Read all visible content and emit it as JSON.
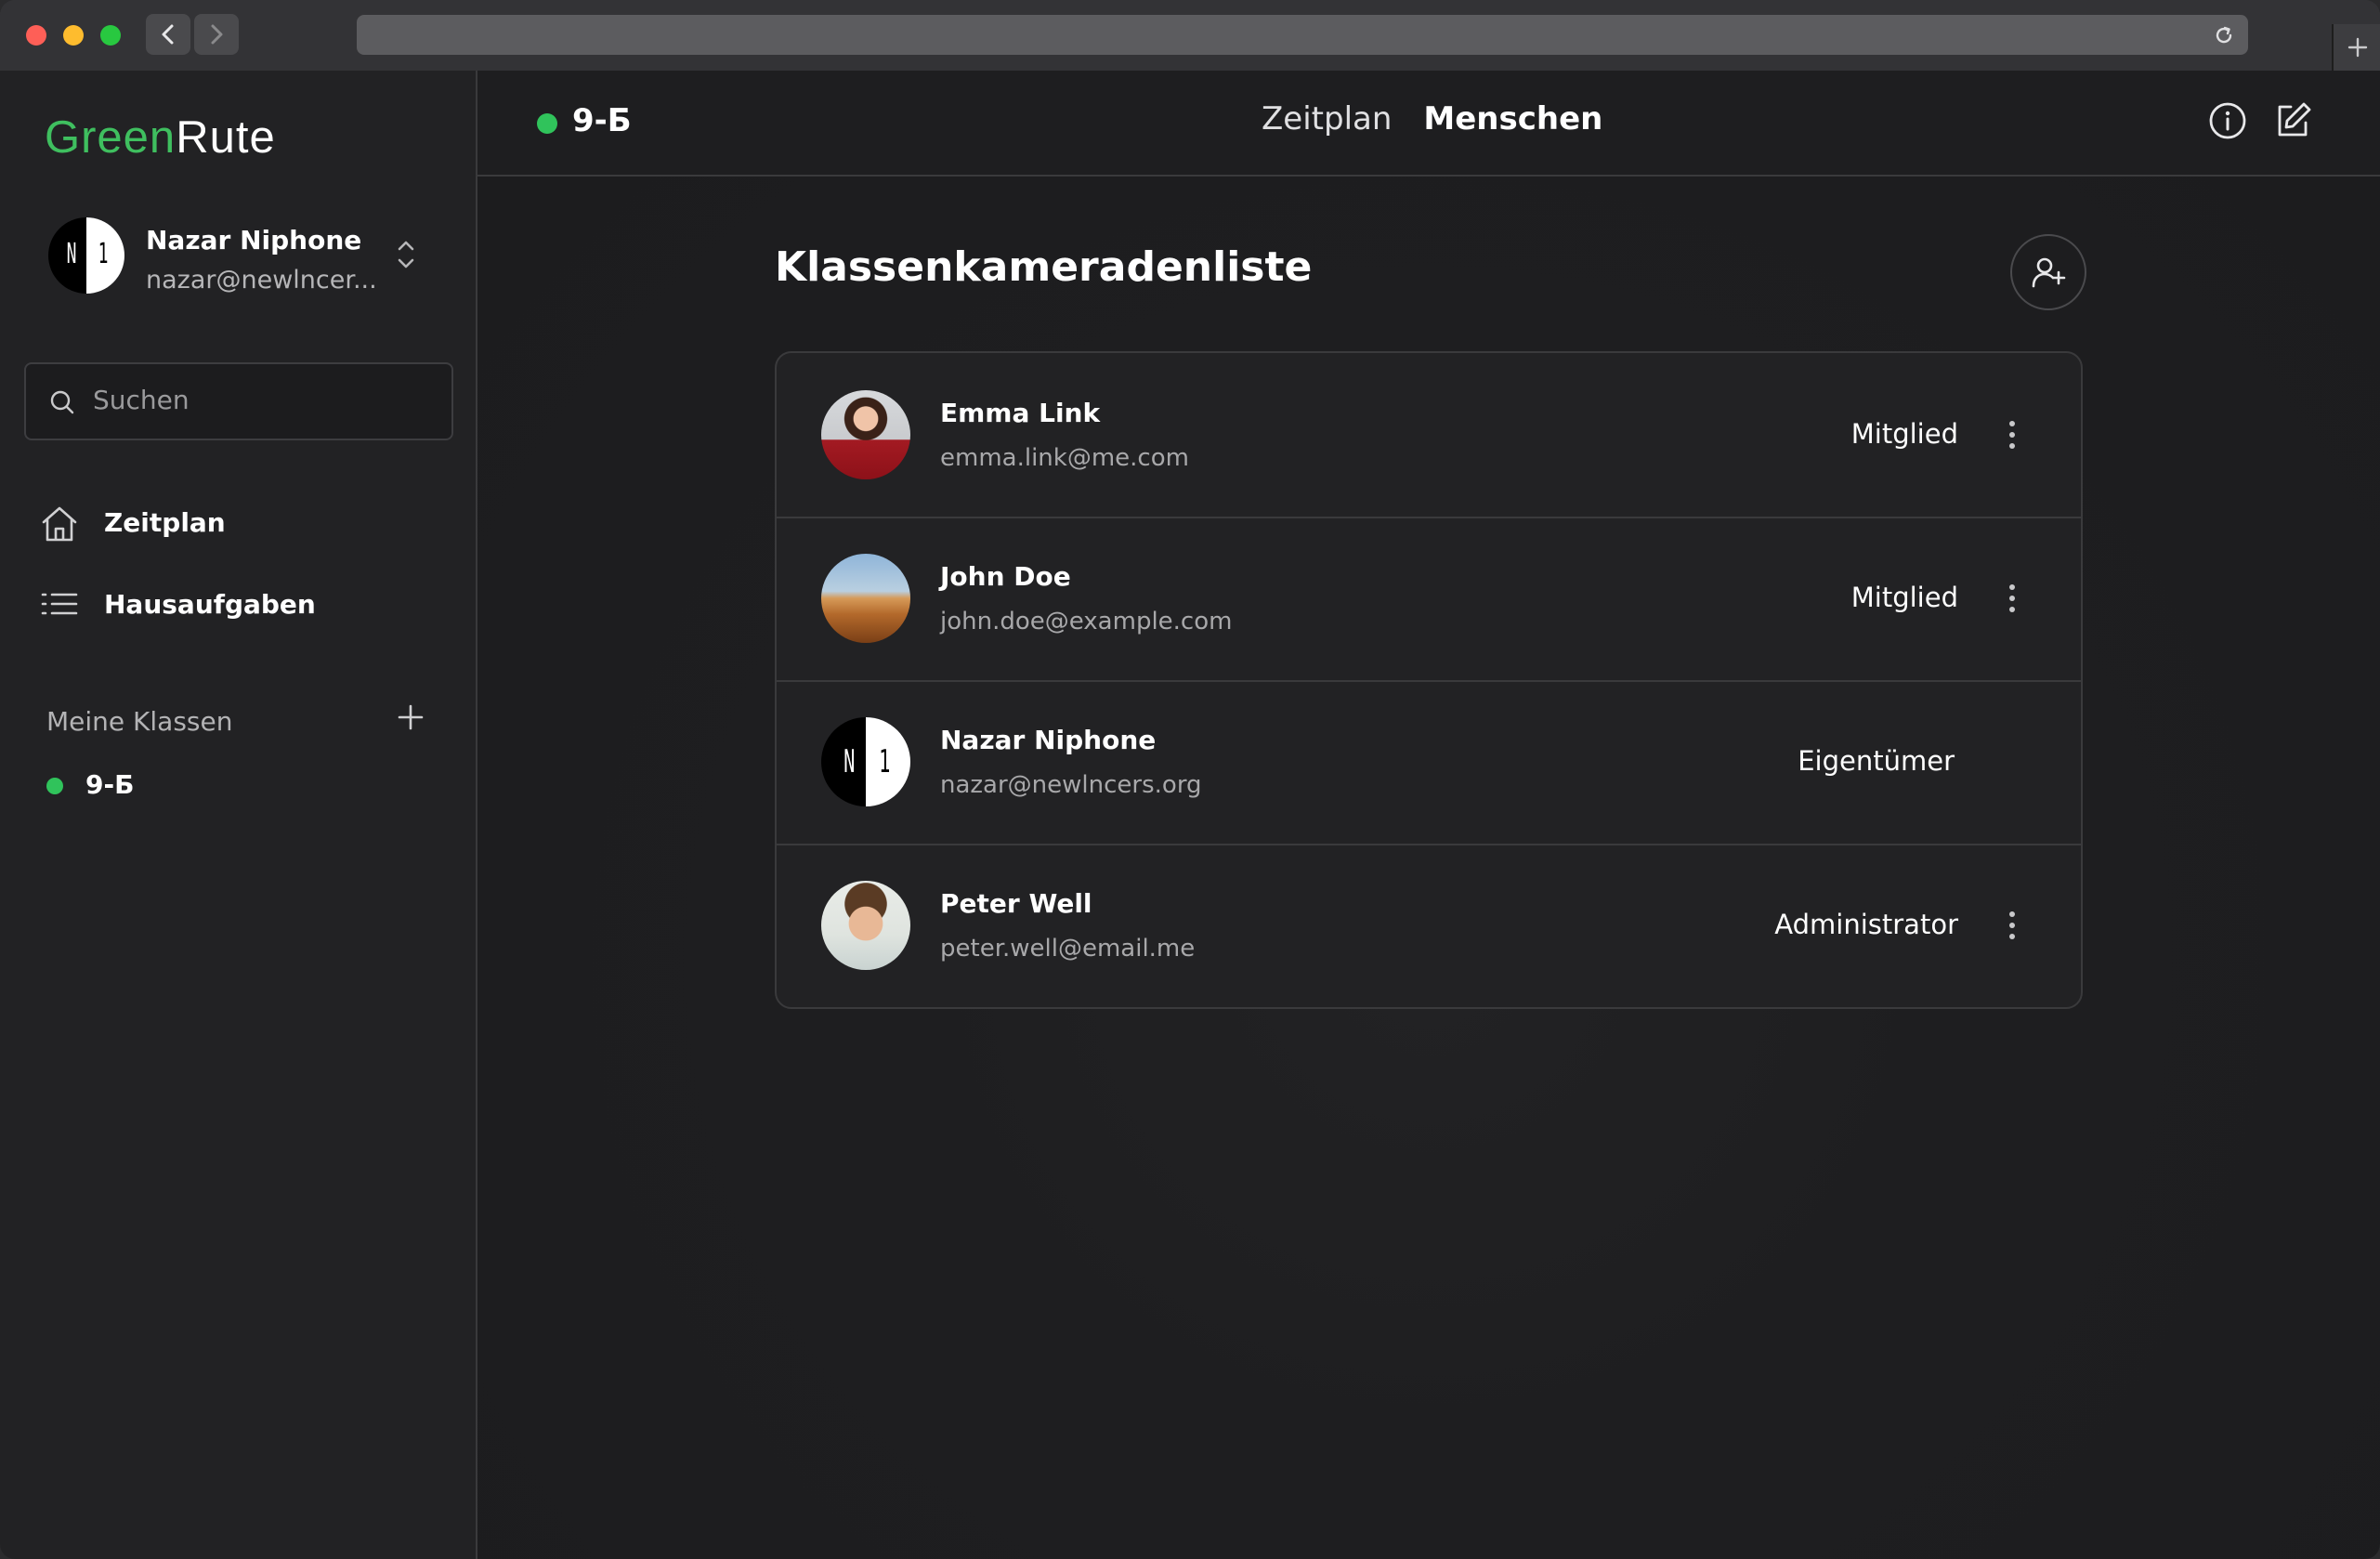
{
  "app": {
    "logo_green": "Green",
    "logo_white": "Rute"
  },
  "user": {
    "name": "Nazar Niphone",
    "email": "nazar@newlncer..."
  },
  "search": {
    "placeholder": "Suchen"
  },
  "sidebar": {
    "items": [
      {
        "label": "Zeitplan",
        "icon": "home-icon"
      },
      {
        "label": "Hausaufgaben",
        "icon": "list-icon"
      }
    ],
    "section_title": "Meine Klassen",
    "classes": [
      {
        "label": "9-Б",
        "status_color": "#30c35b"
      }
    ]
  },
  "header": {
    "class_name": "9-Б",
    "tabs": [
      {
        "label": "Zeitplan",
        "active": false
      },
      {
        "label": "Menschen",
        "active": true
      }
    ]
  },
  "list": {
    "title": "Klassenkameradenliste",
    "members": [
      {
        "name": "Emma Link",
        "email": "emma.link@me.com",
        "role": "Mitglied",
        "has_menu": true
      },
      {
        "name": "John Doe",
        "email": "john.doe@example.com",
        "role": "Mitglied",
        "has_menu": true
      },
      {
        "name": "Nazar Niphone",
        "email": "nazar@newlncers.org",
        "role": "Eigentümer",
        "has_menu": false
      },
      {
        "name": "Peter Well",
        "email": "peter.well@email.me",
        "role": "Administrator",
        "has_menu": true
      }
    ]
  },
  "colors": {
    "accent_green": "#30c35b",
    "logo_green": "#3fbf5f",
    "background": "#1c1c1e",
    "sidebar": "#222224"
  }
}
